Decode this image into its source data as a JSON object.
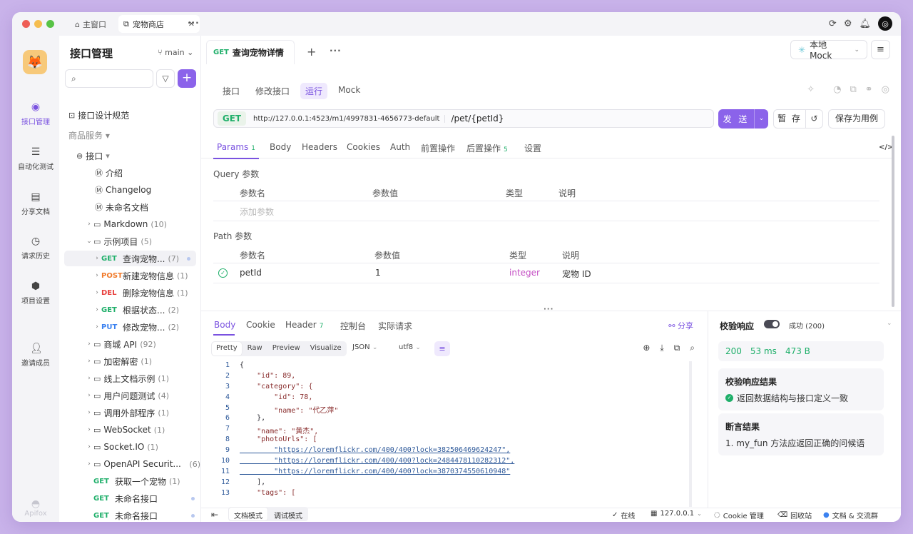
{
  "titlebar": {
    "tabs": [
      {
        "label": "主窗口"
      },
      {
        "label": "宠物商店"
      }
    ]
  },
  "leftnav": {
    "items": [
      {
        "label": "接口管理"
      },
      {
        "label": "自动化测试"
      },
      {
        "label": "分享文档"
      },
      {
        "label": "请求历史"
      },
      {
        "label": "项目设置"
      },
      {
        "label": "邀请成员"
      }
    ],
    "brand": "Apifox"
  },
  "sidebar": {
    "title": "接口管理",
    "branch": "main",
    "tree": [
      {
        "label": "接口设计规范"
      },
      {
        "label": "商品服务 ▾"
      },
      {
        "label": "接口"
      },
      {
        "label": "介绍"
      },
      {
        "label": "Changelog"
      },
      {
        "label": "未命名文档"
      },
      {
        "label": "Markdown",
        "count": "(10)"
      },
      {
        "label": "示例项目",
        "count": "(5)"
      },
      {
        "method": "GET",
        "label": "查询宠物...",
        "count": "(7)"
      },
      {
        "method": "POST",
        "label": "新建宠物信息",
        "count": "(1)"
      },
      {
        "method": "DEL",
        "label": "删除宠物信息",
        "count": "(1)"
      },
      {
        "method": "GET",
        "label": "根据状态...",
        "count": "(2)"
      },
      {
        "method": "PUT",
        "label": "修改宠物...",
        "count": "(2)"
      },
      {
        "label": "商城 API",
        "count": "(92)"
      },
      {
        "label": "加密解密",
        "count": "(1)"
      },
      {
        "label": "线上文档示例",
        "count": "(1)"
      },
      {
        "label": "用户问题测试",
        "count": "(4)"
      },
      {
        "label": "调用外部程序",
        "count": "(1)"
      },
      {
        "label": "WebSocket",
        "count": "(1)"
      },
      {
        "label": "Socket.IO",
        "count": "(1)"
      },
      {
        "label": "OpenAPI Securit...",
        "count": "(6)"
      },
      {
        "method": "GET",
        "label": "获取一个宠物",
        "count": "(1)"
      },
      {
        "method": "GET",
        "label": "未命名接口"
      },
      {
        "method": "GET",
        "label": "未命名接口"
      }
    ]
  },
  "request": {
    "tab_method": "GET",
    "tab_title": "查询宠物详情",
    "env": "本地 Mock",
    "subnav": [
      "接口",
      "修改接口",
      "运行",
      "Mock"
    ],
    "method": "GET",
    "base_url": "http://127.0.0.1:4523/m1/4997831-4656773-default",
    "path": "/pet/{petId}",
    "send": "发 送",
    "save": "暂 存",
    "save_case": "保存为用例",
    "param_tabs": [
      {
        "label": "Params",
        "count": "1"
      },
      {
        "label": "Body"
      },
      {
        "label": "Headers"
      },
      {
        "label": "Cookies"
      },
      {
        "label": "Auth"
      },
      {
        "label": "前置操作"
      },
      {
        "label": "后置操作",
        "count": "5"
      },
      {
        "label": "设置"
      }
    ],
    "query_label": "Query 参数",
    "query_headers": [
      "参数名",
      "参数值",
      "类型",
      "说明"
    ],
    "query_placeholder": "添加参数",
    "path_label": "Path 参数",
    "path_headers": [
      "参数名",
      "参数值",
      "类型",
      "说明"
    ],
    "path_row": {
      "name": "petId",
      "value": "1",
      "type": "integer",
      "desc": "宠物 ID"
    }
  },
  "response": {
    "tabs": [
      {
        "label": "Body"
      },
      {
        "label": "Cookie"
      },
      {
        "label": "Header",
        "count": "7"
      },
      {
        "label": "控制台"
      },
      {
        "label": "实际请求"
      }
    ],
    "share": "分享",
    "formats": [
      "Pretty",
      "Raw",
      "Preview",
      "Visualize"
    ],
    "type": "JSON",
    "encoding": "utf8",
    "code": [
      [
        "1",
        "{"
      ],
      [
        "2",
        "    \"id\": 89,"
      ],
      [
        "3",
        "    \"category\": {"
      ],
      [
        "4",
        "        \"id\": 78,"
      ],
      [
        "5",
        "        \"name\": \"代乙萍\""
      ],
      [
        "6",
        "    },"
      ],
      [
        "7",
        "    \"name\": \"黄杰\","
      ],
      [
        "8",
        "    \"photoUrls\": ["
      ],
      [
        "9",
        "        \"https://loremflickr.com/400/400?lock=382506469624247\","
      ],
      [
        "10",
        "        \"https://loremflickr.com/400/400?lock=2484478110282312\","
      ],
      [
        "11",
        "        \"https://loremflickr.com/400/400?lock=3870374550610948\""
      ],
      [
        "12",
        "    ],"
      ],
      [
        "13",
        "    \"tags\": ["
      ]
    ]
  },
  "validation": {
    "title": "校验响应",
    "status": "成功 (200)",
    "metrics": [
      "200",
      "53 ms",
      "473 B"
    ],
    "result_title": "校验响应结果",
    "result_text": "返回数据结构与接口定义一致",
    "assert_title": "断言结果",
    "assert_text": "1.  my_fun 方法应返回正确的问候语"
  },
  "statusbar": {
    "modes": [
      "文档模式",
      "调试模式"
    ],
    "online": "在线",
    "host": "127.0.0.1",
    "cookie": "Cookie 管理",
    "recycle": "回收站",
    "docs": "文档 & 交流群"
  }
}
